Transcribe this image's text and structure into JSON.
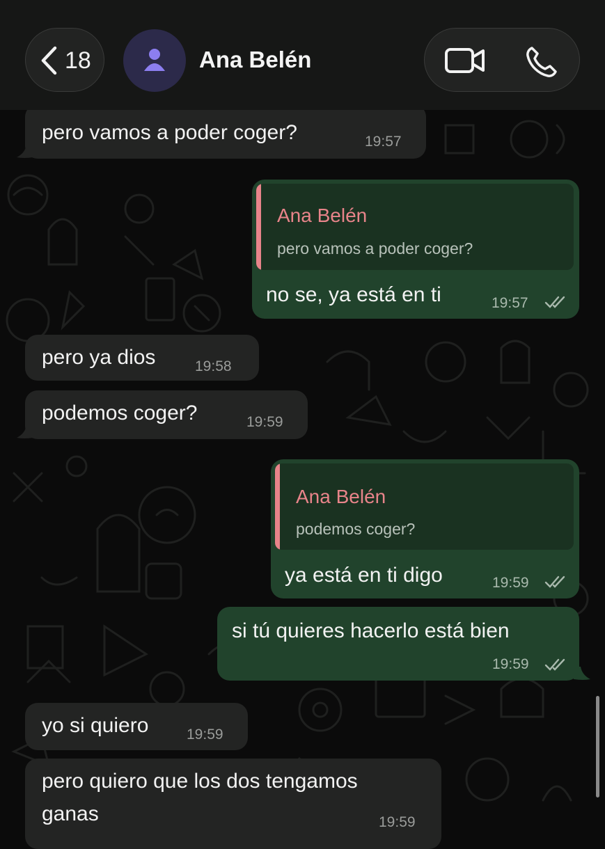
{
  "header": {
    "back_count": "18",
    "contact_name": "Ana Belén"
  },
  "messages": [
    {
      "dir": "in",
      "text": "pero vamos a poder coger?",
      "time": "19:57"
    },
    {
      "dir": "out",
      "quote_author": "Ana Belén",
      "quote_text": "pero vamos a poder coger?",
      "text": "no se, ya está en ti",
      "time": "19:57",
      "status": "read"
    },
    {
      "dir": "in",
      "text": "pero ya dios",
      "time": "19:58"
    },
    {
      "dir": "in",
      "text": "podemos coger?",
      "time": "19:59"
    },
    {
      "dir": "out",
      "quote_author": "Ana Belén",
      "quote_text": "podemos coger?",
      "text": "ya está en ti digo",
      "time": "19:59",
      "status": "read"
    },
    {
      "dir": "out",
      "text": "si tú quieres hacerlo está bien",
      "time": "19:59",
      "status": "read"
    },
    {
      "dir": "in",
      "text": "yo si quiero",
      "time": "19:59"
    },
    {
      "dir": "in",
      "text_lines": [
        "pero quiero que los dos tengamos",
        "ganas"
      ],
      "time": "19:59"
    }
  ],
  "colors": {
    "incoming_bubble": "#232423",
    "outgoing_bubble": "#21432c",
    "quote_accent": "#e8848a",
    "read_ticks": "#a9b9ad"
  }
}
